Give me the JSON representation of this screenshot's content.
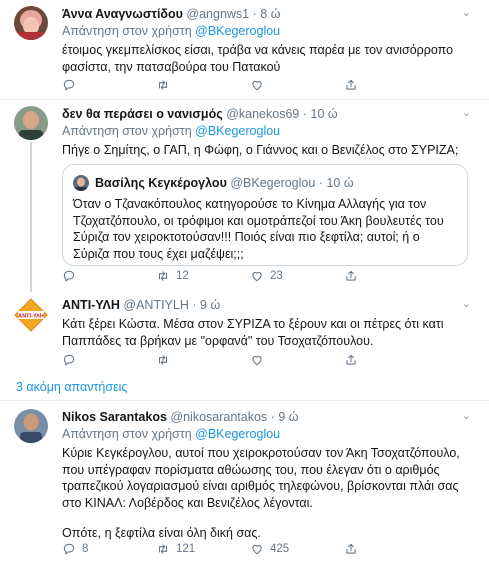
{
  "tweets": [
    {
      "name": "Άννα Αναγνωστίδου",
      "handle": "@angnws1",
      "time": "8 ώ",
      "reply_prefix": "Απάντηση στον χρήστη",
      "reply_handle": "@BKegeroglou",
      "text": "έτοιμος γκεμπελίσκος είσαι, τράβα να κάνεις παρέα με τον ανισόρροπο φασίστα, την πατσαβούρα του Πατακού",
      "replies": "",
      "retweets": "",
      "likes": ""
    },
    {
      "name": "δεν θα περάσει ο νανισμός",
      "handle": "@kanekos69",
      "time": "10 ώ",
      "reply_prefix": "Απάντηση στον χρήστη",
      "reply_handle": "@BKegeroglou",
      "text": "Πήγε ο Σημίτης, ο ΓΑΠ, η Φώφη, ο Γιάννος και ο Βενιζέλος στο ΣΥΡΙΖΑ;",
      "quote": {
        "name": "Βασίλης Κεγκέρογλου",
        "handle": "@BKegeroglou",
        "time": "10 ώ",
        "text": "Όταν ο Τζανακόπουλος κατηγορούσε το Κίνημα Αλλαγής για τον Τζοχατζόπουλο, οι τρόφιμοι και ομοτράπεζοί του Άκη βουλευτές του Σύριζα τον χειροκτοτούσαν!!! Ποιός είναι πιο ξεφτίλα; αυτοί; ή ο Σύριζα που τους έχει μαζέψει;;;"
      },
      "replies": "",
      "retweets": "12",
      "likes": "23"
    },
    {
      "name": "ΑΝΤΙ-ΥΛΗ",
      "handle": "@ANTIYLH",
      "time": "9 ώ",
      "text": "Κάτι ξέρει Κώστα. Μέσα στον ΣΥΡΙΖΑ το ξέρουν και οι πέτρες ότι κατι Παππάδες τα βρήκαν με \"ορφανά\" του Τσοχατζόπουλου.",
      "avatar_text": "ΑΝΤΙ-ΥΛΗ",
      "replies": "",
      "retweets": "",
      "likes": ""
    },
    {
      "name": "Nikos Sarantakos",
      "handle": "@nikosarantakos",
      "time": "9 ώ",
      "reply_prefix": "Απάντηση στον χρήστη",
      "reply_handle": "@BKegeroglou",
      "text": "Κύριε Κεγκέρογλου, αυτοί που χειροκροτούσαν τον Άκη Τσοχατζόπουλο, που υπέγραφαν πορίσματα αθώωσης του, που έλεγαν ότι ο αριθμός τραπεζικού λογαριασμού είναι αριθμός τηλεφώνου, βρίσκονται πλάι σας στο ΚΙΝΑΛ: Λοβέρδος και Βενιζέλος λέγονται.",
      "text2": "Οπότε, η ξεφτίλα είναι όλη δική σας.",
      "replies": "8",
      "retweets": "121",
      "likes": "425"
    }
  ],
  "show_more": "3 ακόμη απαντήσεις",
  "colors": {
    "link": "#1b95e0",
    "secondary_text": "#657786",
    "divider": "#e6ecf0"
  }
}
